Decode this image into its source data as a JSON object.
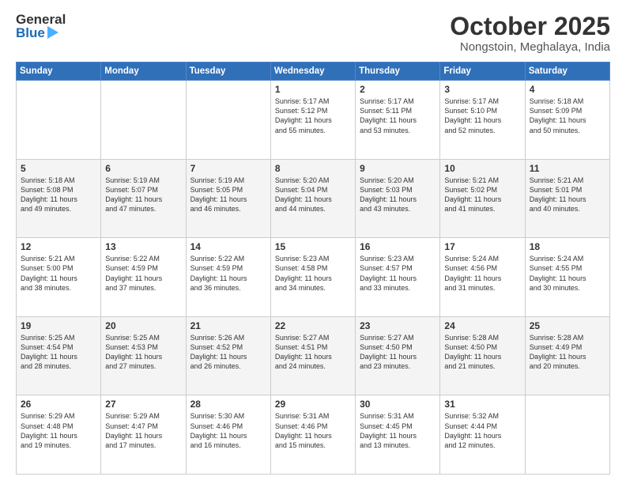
{
  "header": {
    "logo_line1": "General",
    "logo_line2": "Blue",
    "month_title": "October 2025",
    "location": "Nongstoin, Meghalaya, India"
  },
  "weekdays": [
    "Sunday",
    "Monday",
    "Tuesday",
    "Wednesday",
    "Thursday",
    "Friday",
    "Saturday"
  ],
  "weeks": [
    [
      {
        "day": "",
        "info": ""
      },
      {
        "day": "",
        "info": ""
      },
      {
        "day": "",
        "info": ""
      },
      {
        "day": "1",
        "info": "Sunrise: 5:17 AM\nSunset: 5:12 PM\nDaylight: 11 hours\nand 55 minutes."
      },
      {
        "day": "2",
        "info": "Sunrise: 5:17 AM\nSunset: 5:11 PM\nDaylight: 11 hours\nand 53 minutes."
      },
      {
        "day": "3",
        "info": "Sunrise: 5:17 AM\nSunset: 5:10 PM\nDaylight: 11 hours\nand 52 minutes."
      },
      {
        "day": "4",
        "info": "Sunrise: 5:18 AM\nSunset: 5:09 PM\nDaylight: 11 hours\nand 50 minutes."
      }
    ],
    [
      {
        "day": "5",
        "info": "Sunrise: 5:18 AM\nSunset: 5:08 PM\nDaylight: 11 hours\nand 49 minutes."
      },
      {
        "day": "6",
        "info": "Sunrise: 5:19 AM\nSunset: 5:07 PM\nDaylight: 11 hours\nand 47 minutes."
      },
      {
        "day": "7",
        "info": "Sunrise: 5:19 AM\nSunset: 5:05 PM\nDaylight: 11 hours\nand 46 minutes."
      },
      {
        "day": "8",
        "info": "Sunrise: 5:20 AM\nSunset: 5:04 PM\nDaylight: 11 hours\nand 44 minutes."
      },
      {
        "day": "9",
        "info": "Sunrise: 5:20 AM\nSunset: 5:03 PM\nDaylight: 11 hours\nand 43 minutes."
      },
      {
        "day": "10",
        "info": "Sunrise: 5:21 AM\nSunset: 5:02 PM\nDaylight: 11 hours\nand 41 minutes."
      },
      {
        "day": "11",
        "info": "Sunrise: 5:21 AM\nSunset: 5:01 PM\nDaylight: 11 hours\nand 40 minutes."
      }
    ],
    [
      {
        "day": "12",
        "info": "Sunrise: 5:21 AM\nSunset: 5:00 PM\nDaylight: 11 hours\nand 38 minutes."
      },
      {
        "day": "13",
        "info": "Sunrise: 5:22 AM\nSunset: 4:59 PM\nDaylight: 11 hours\nand 37 minutes."
      },
      {
        "day": "14",
        "info": "Sunrise: 5:22 AM\nSunset: 4:59 PM\nDaylight: 11 hours\nand 36 minutes."
      },
      {
        "day": "15",
        "info": "Sunrise: 5:23 AM\nSunset: 4:58 PM\nDaylight: 11 hours\nand 34 minutes."
      },
      {
        "day": "16",
        "info": "Sunrise: 5:23 AM\nSunset: 4:57 PM\nDaylight: 11 hours\nand 33 minutes."
      },
      {
        "day": "17",
        "info": "Sunrise: 5:24 AM\nSunset: 4:56 PM\nDaylight: 11 hours\nand 31 minutes."
      },
      {
        "day": "18",
        "info": "Sunrise: 5:24 AM\nSunset: 4:55 PM\nDaylight: 11 hours\nand 30 minutes."
      }
    ],
    [
      {
        "day": "19",
        "info": "Sunrise: 5:25 AM\nSunset: 4:54 PM\nDaylight: 11 hours\nand 28 minutes."
      },
      {
        "day": "20",
        "info": "Sunrise: 5:25 AM\nSunset: 4:53 PM\nDaylight: 11 hours\nand 27 minutes."
      },
      {
        "day": "21",
        "info": "Sunrise: 5:26 AM\nSunset: 4:52 PM\nDaylight: 11 hours\nand 26 minutes."
      },
      {
        "day": "22",
        "info": "Sunrise: 5:27 AM\nSunset: 4:51 PM\nDaylight: 11 hours\nand 24 minutes."
      },
      {
        "day": "23",
        "info": "Sunrise: 5:27 AM\nSunset: 4:50 PM\nDaylight: 11 hours\nand 23 minutes."
      },
      {
        "day": "24",
        "info": "Sunrise: 5:28 AM\nSunset: 4:50 PM\nDaylight: 11 hours\nand 21 minutes."
      },
      {
        "day": "25",
        "info": "Sunrise: 5:28 AM\nSunset: 4:49 PM\nDaylight: 11 hours\nand 20 minutes."
      }
    ],
    [
      {
        "day": "26",
        "info": "Sunrise: 5:29 AM\nSunset: 4:48 PM\nDaylight: 11 hours\nand 19 minutes."
      },
      {
        "day": "27",
        "info": "Sunrise: 5:29 AM\nSunset: 4:47 PM\nDaylight: 11 hours\nand 17 minutes."
      },
      {
        "day": "28",
        "info": "Sunrise: 5:30 AM\nSunset: 4:46 PM\nDaylight: 11 hours\nand 16 minutes."
      },
      {
        "day": "29",
        "info": "Sunrise: 5:31 AM\nSunset: 4:46 PM\nDaylight: 11 hours\nand 15 minutes."
      },
      {
        "day": "30",
        "info": "Sunrise: 5:31 AM\nSunset: 4:45 PM\nDaylight: 11 hours\nand 13 minutes."
      },
      {
        "day": "31",
        "info": "Sunrise: 5:32 AM\nSunset: 4:44 PM\nDaylight: 11 hours\nand 12 minutes."
      },
      {
        "day": "",
        "info": ""
      }
    ]
  ]
}
